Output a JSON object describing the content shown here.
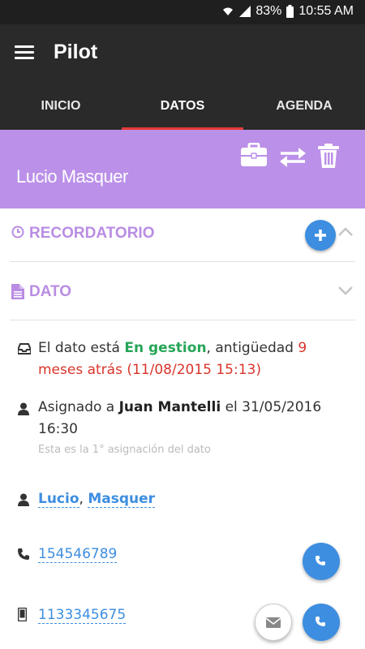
{
  "status_bar": {
    "battery": "83%",
    "time": "10:55 AM"
  },
  "app": {
    "title": "Pilot"
  },
  "tabs": [
    {
      "label": "INICIO"
    },
    {
      "label": "DATOS"
    },
    {
      "label": "AGENDA"
    }
  ],
  "header": {
    "name": "Lucio Masquer"
  },
  "sections": {
    "recordatorio": "RECORDATORIO",
    "dato": "DATO"
  },
  "status_row": {
    "prefix": "El dato está ",
    "state": "En gestion",
    "middle": ", antigüedad ",
    "age": "9 meses atrás (11/08/2015 15:13)"
  },
  "assign_row": {
    "prefix": "Asignado a ",
    "person": "Juan Mantelli",
    "suffix": " el 31/05/2016 16:30",
    "note": "Esta es la 1° asignación del dato"
  },
  "contact": {
    "first_name": "Lucio",
    "separator": ", ",
    "last_name": "Masquer",
    "phone": "154546789",
    "mobile": "1133345675"
  },
  "colors": {
    "accent_purple": "#bb90e8",
    "action_blue": "#3d8ee0",
    "tab_indicator": "#e53935",
    "status_green": "#27a558",
    "age_red": "#d9342b"
  }
}
